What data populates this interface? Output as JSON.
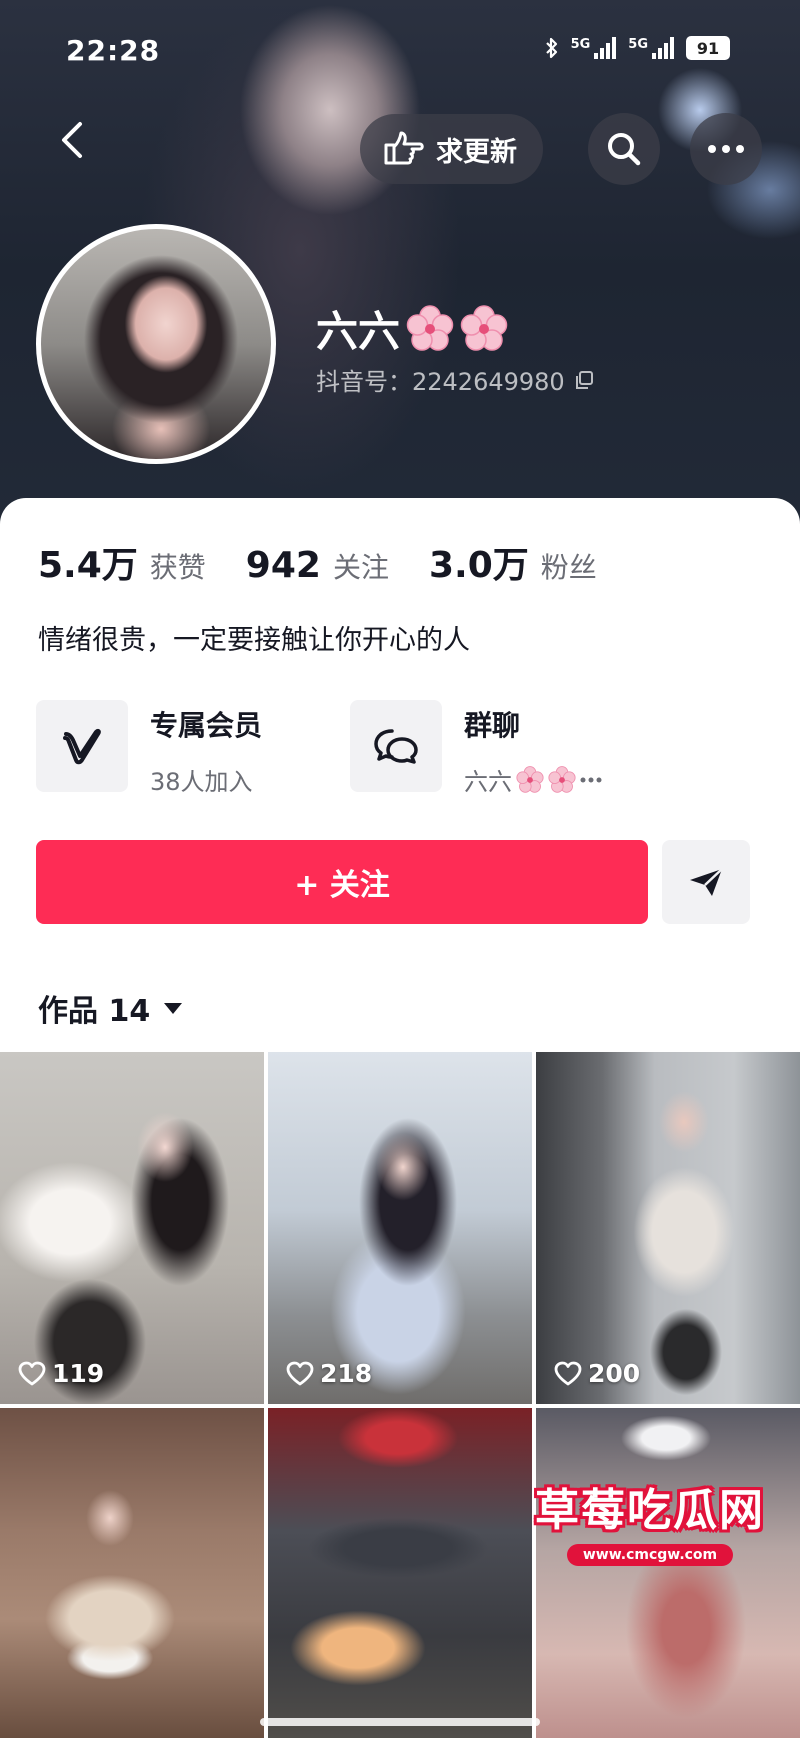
{
  "status": {
    "time": "22:28",
    "network_1": "5G",
    "network_2": "5G",
    "battery": "91"
  },
  "header": {
    "request_update_label": "求更新",
    "icons": [
      "back-arrow-icon",
      "hand-pointing-icon",
      "search-icon",
      "more-icon"
    ]
  },
  "profile": {
    "name": "六六",
    "douyin_id": "抖音号：2242649980"
  },
  "stats": {
    "likes_value": "5.4万",
    "likes_label": "获赞",
    "following_value": "942",
    "following_label": "关注",
    "fans_value": "3.0万",
    "fans_label": "粉丝"
  },
  "bio": "情绪很贵，一定要接触让你开心的人",
  "entries": {
    "membership_title": "专属会员",
    "membership_sub": "38人加入",
    "group_title": "群聊",
    "group_sub": "六六"
  },
  "actions": {
    "follow_label": "+ 关注"
  },
  "works": {
    "tab_label": "作品 14"
  },
  "videos": [
    {
      "likes": "119"
    },
    {
      "likes": "218"
    },
    {
      "likes": "200"
    },
    {
      "likes": ""
    },
    {
      "likes": ""
    },
    {
      "likes": ""
    }
  ],
  "watermark": {
    "title": "草莓吃瓜网",
    "url": "www.cmcgw.com"
  },
  "colors": {
    "accent": "#fe2c55",
    "text_primary": "#161823",
    "text_secondary": "#6b6d75"
  }
}
